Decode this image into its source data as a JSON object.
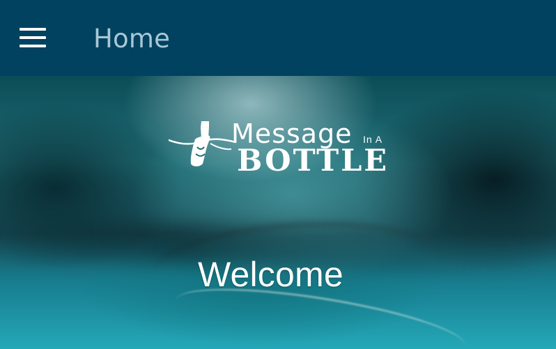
{
  "app_bar": {
    "title": "Home",
    "menu_icon": "menu-icon",
    "background": "#004260",
    "title_color": "#a9c7d6"
  },
  "hero": {
    "logo": {
      "message": "Message",
      "in_a": "In A",
      "bottle": "BOTTLE",
      "icon": "bottle-logo-icon"
    },
    "welcome_text": "Welcome"
  },
  "colors": {
    "accent_text": "#ffffff",
    "water_light": "#24a8b8",
    "water_dark": "#0b4d57"
  }
}
